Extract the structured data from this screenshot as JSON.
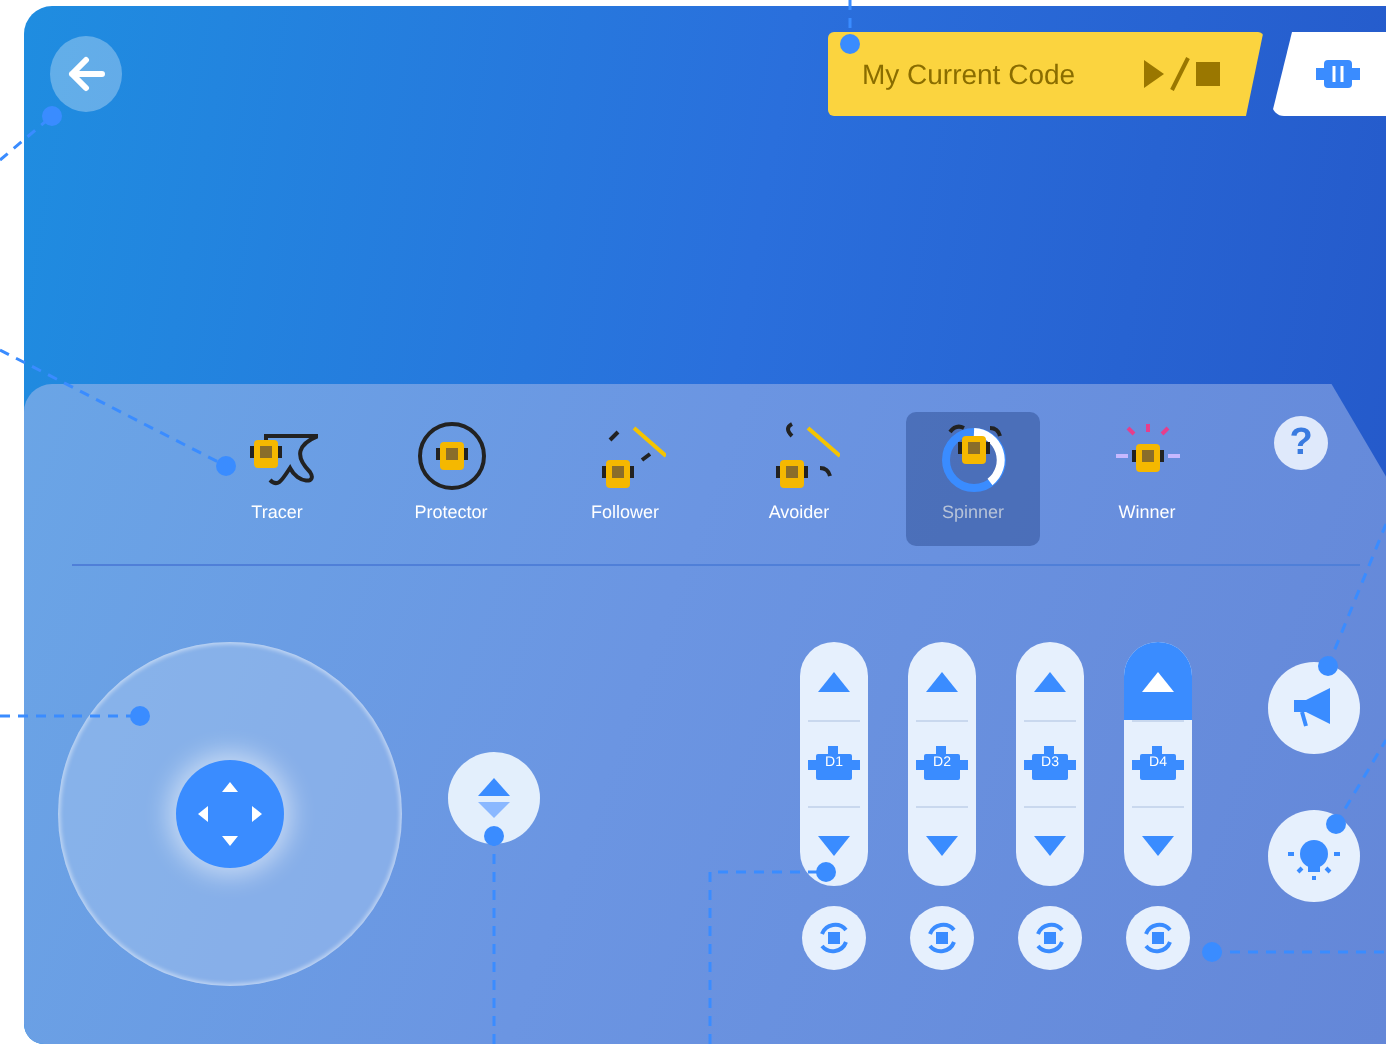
{
  "code_block": {
    "label": "My Current Code"
  },
  "help": {
    "label": "?"
  },
  "modes": [
    {
      "kind": "tracer",
      "label": "Tracer",
      "selected": false
    },
    {
      "kind": "protector",
      "label": "Protector",
      "selected": false
    },
    {
      "kind": "follower",
      "label": "Follower",
      "selected": false
    },
    {
      "kind": "avoider",
      "label": "Avoider",
      "selected": false
    },
    {
      "kind": "spinner",
      "label": "Spinner",
      "selected": true
    },
    {
      "kind": "winner",
      "label": "Winner",
      "selected": false
    }
  ],
  "motors": [
    {
      "label": "D1",
      "up_active": false
    },
    {
      "label": "D2",
      "up_active": false
    },
    {
      "label": "D3",
      "up_active": false
    },
    {
      "label": "D4",
      "up_active": true
    }
  ]
}
